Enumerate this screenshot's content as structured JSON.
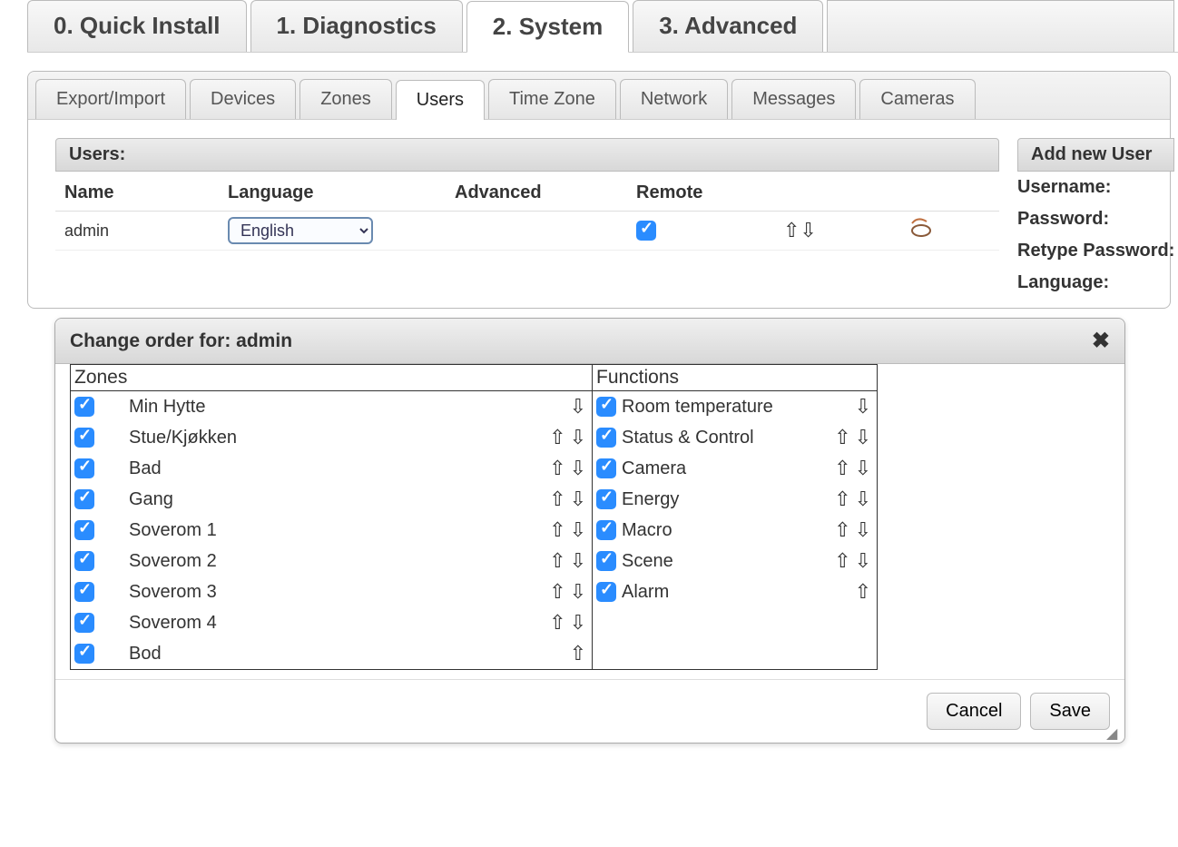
{
  "mainTabs": [
    "0. Quick Install",
    "1. Diagnostics",
    "2. System",
    "3. Advanced"
  ],
  "mainActive": 2,
  "subTabs": [
    "Export/Import",
    "Devices",
    "Zones",
    "Users",
    "Time Zone",
    "Network",
    "Messages",
    "Cameras"
  ],
  "subActive": 3,
  "usersSection": {
    "title": "Users:",
    "cols": [
      "Name",
      "Language",
      "Advanced",
      "Remote"
    ],
    "row": {
      "name": "admin",
      "language": "English",
      "remoteChecked": true
    }
  },
  "addSection": {
    "title": "Add new User",
    "labels": [
      "Username:",
      "Password:",
      "Retype Password:",
      "Language:"
    ]
  },
  "dialog": {
    "title": "Change order for: admin",
    "zonesTitle": "Zones",
    "functionsTitle": "Functions",
    "zones": [
      {
        "label": "Min Hytte",
        "up": false,
        "down": true
      },
      {
        "label": "Stue/Kjøkken",
        "up": true,
        "down": true
      },
      {
        "label": "Bad",
        "up": true,
        "down": true
      },
      {
        "label": "Gang",
        "up": true,
        "down": true
      },
      {
        "label": "Soverom 1",
        "up": true,
        "down": true
      },
      {
        "label": "Soverom 2",
        "up": true,
        "down": true
      },
      {
        "label": "Soverom 3",
        "up": true,
        "down": true
      },
      {
        "label": "Soverom 4",
        "up": true,
        "down": true
      },
      {
        "label": "Bod",
        "up": true,
        "down": false
      }
    ],
    "functions": [
      {
        "label": "Room temperature",
        "up": false,
        "down": true
      },
      {
        "label": "Status & Control",
        "up": true,
        "down": true
      },
      {
        "label": "Camera",
        "up": true,
        "down": true
      },
      {
        "label": "Energy",
        "up": true,
        "down": true
      },
      {
        "label": "Macro",
        "up": true,
        "down": true
      },
      {
        "label": "Scene",
        "up": true,
        "down": true
      },
      {
        "label": "Alarm",
        "up": true,
        "down": false
      }
    ],
    "buttons": {
      "cancel": "Cancel",
      "save": "Save"
    }
  }
}
